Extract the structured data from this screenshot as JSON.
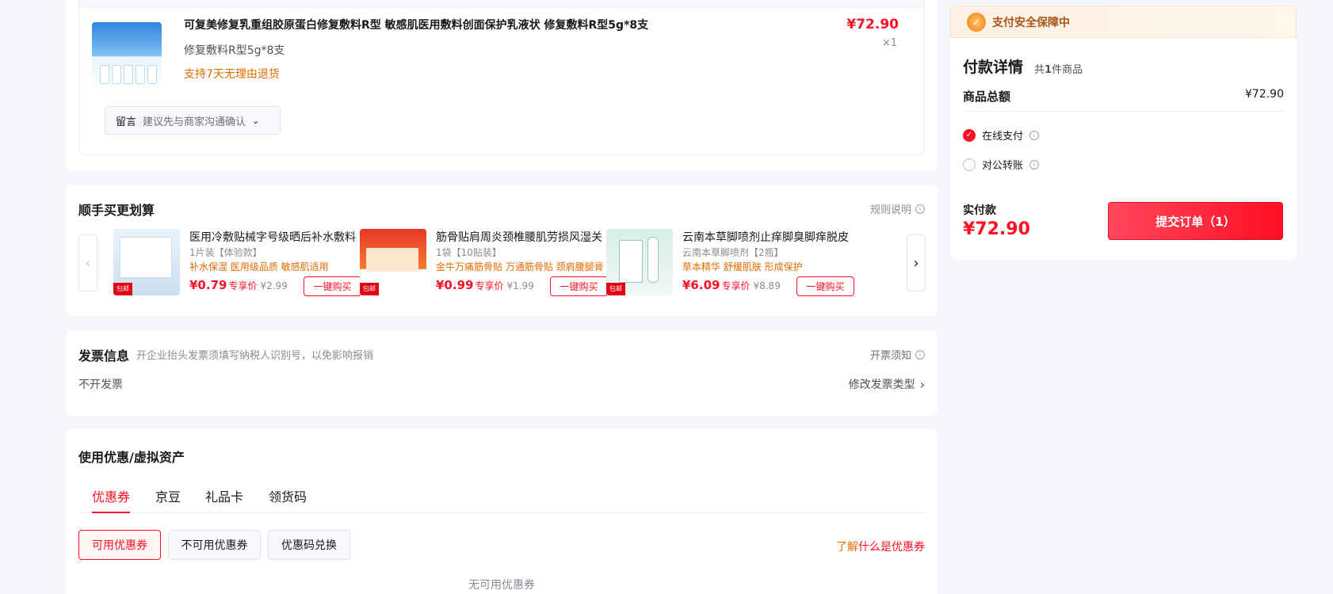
{
  "product": {
    "title": "可复美修复乳重组胶原蛋白修复敷料R型 敏感肌医用敷料创面保护乳液状 修复敷料R型5g*8支",
    "spec": "修复敷料R型5g*8支",
    "return_policy": "支持7天无理由退货",
    "price": "¥72.90",
    "quantity": "×1",
    "note_label": "留言",
    "note_placeholder": "建议先与商家沟通确认"
  },
  "addon": {
    "title": "顺手买更划算",
    "rules": "规则说明",
    "items": [
      {
        "name": "医用冷敷贴械字号级晒后补水敷料",
        "spec": "1片装【体验款】",
        "selling": "补水保湿 医用级品质 敏感肌适用",
        "price": "¥0.79",
        "exclusive": "专享价",
        "original": "¥2.99",
        "buy": "一键购买",
        "tag": "包邮"
      },
      {
        "name": "筋骨贴肩周炎颈椎腰肌劳损风湿关",
        "spec": "1袋【10贴装】",
        "selling": "金牛万痛筋骨贴 万通筋骨贴 颈肩腰腿膏",
        "price": "¥0.99",
        "exclusive": "专享价",
        "original": "¥1.99",
        "buy": "一键购买",
        "tag": "包邮"
      },
      {
        "name": "云南本草脚喷剂止痒脚臭脚痒脱皮",
        "spec": "云南本草脚喷剂【2瓶】",
        "selling": "草本精华 舒缓肌肤 形成保护",
        "price": "¥6.09",
        "exclusive": "专享价",
        "original": "¥8.89",
        "buy": "一键购买",
        "tag": "包邮"
      }
    ]
  },
  "invoice": {
    "title": "发票信息",
    "hint": "开企业抬头发票须填写纳税人识别号，以免影响报销",
    "notice": "开票须知",
    "value": "不开发票",
    "change": "修改发票类型"
  },
  "coupons": {
    "title": "使用优惠/虚拟资产",
    "tabs": [
      "优惠券",
      "京豆",
      "礼品卡",
      "领货码"
    ],
    "chips": [
      "可用优惠券",
      "不可用优惠券",
      "优惠码兑换"
    ],
    "learn_prefix": "了解",
    "learn_link": "什么是优惠券",
    "empty": "无可用优惠券"
  },
  "payment": {
    "banner": "支付安全保障中",
    "title": "付款详情",
    "count_prefix": "共",
    "count_num": "1",
    "count_suffix": "件商品",
    "total_label": "商品总额",
    "total_value": "¥72.90",
    "methods": [
      "在线支付",
      "对公转账"
    ],
    "selected_method": "在线支付",
    "actual_label": "实付款",
    "actual_value": "¥72.90",
    "submit": "提交订单（1）"
  },
  "colors": {
    "accent": "#ff0f23",
    "orange": "#e26b00",
    "background": "#f5f6fa"
  }
}
